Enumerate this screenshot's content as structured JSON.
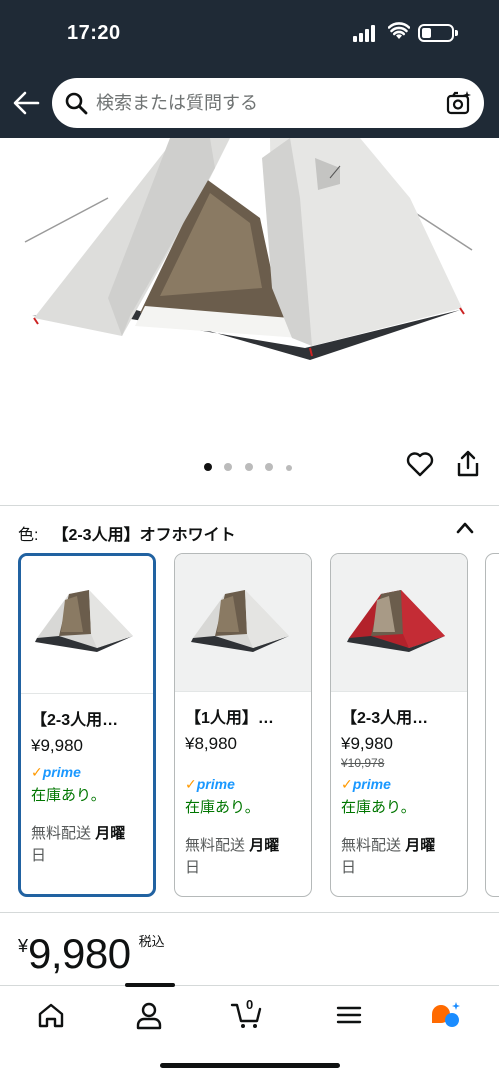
{
  "status_bar": {
    "time": "17:20"
  },
  "search": {
    "placeholder": "検索または質問する"
  },
  "gallery": {
    "total_dots": 5,
    "active_index": 0
  },
  "variants": {
    "label": "色:",
    "selected_value": "【2-3人用】オフホワイト",
    "options": [
      {
        "name": "【2-3人用…",
        "price": "¥9,980",
        "old_price": "",
        "prime": "prime",
        "stock": "在庫あり。",
        "ship": "無料配送",
        "ship_day": "月曜",
        "ship_day2": "日",
        "tent_color": "#d8d8d6"
      },
      {
        "name": "【1人用】…",
        "price": "¥8,980",
        "old_price": "",
        "prime": "prime",
        "stock": "在庫あり。",
        "ship": "無料配送",
        "ship_day": "月曜",
        "ship_day2": "日",
        "tent_color": "#d8d8d6"
      },
      {
        "name": "【2-3人用…",
        "price": "¥9,980",
        "old_price": "¥10,978",
        "prime": "prime",
        "stock": "在庫あり。",
        "ship": "無料配送",
        "ship_day": "月曜",
        "ship_day2": "日",
        "tent_color": "#b3222b"
      }
    ]
  },
  "price": {
    "yen": "¥",
    "amount": "9,980",
    "tax": "税込"
  },
  "bottom_nav": {
    "cart_count": "0"
  },
  "colors": {
    "header_bg": "#1f2a36",
    "prime_blue": "#1a98ff",
    "stock_green": "#007600",
    "selected_border": "#2162a1",
    "rufus_orange": "#ff6a00",
    "rufus_blue": "#1a8cff"
  }
}
